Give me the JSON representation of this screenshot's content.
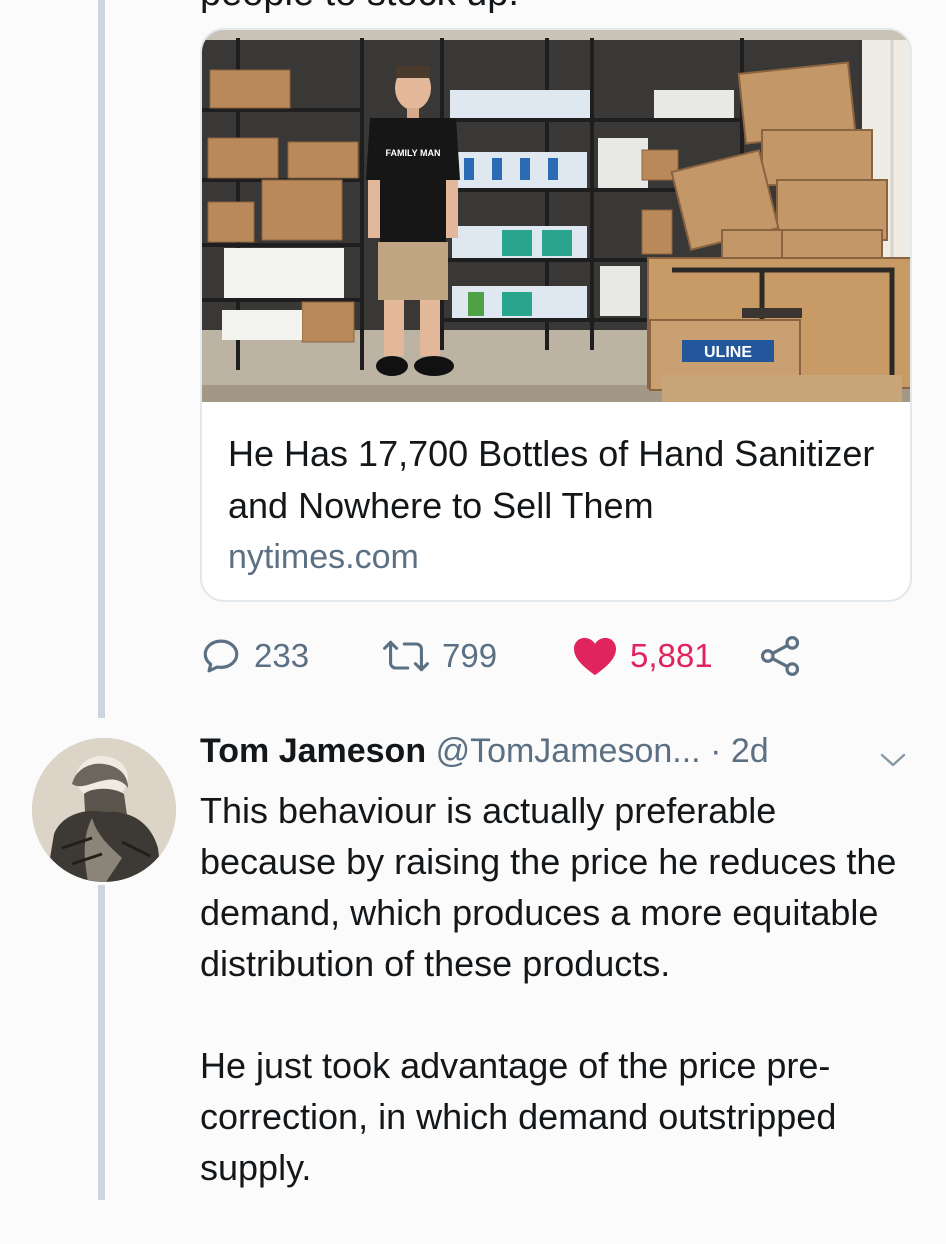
{
  "previous_tweet_tail": "people to stock up.",
  "card": {
    "title": "He Has 17,700 Bottles of Hand Sanitizer and Nowhere to Sell Them",
    "domain": "nytimes.com",
    "image": {
      "shirt_text": "FAMILY MAN",
      "box_label": "ULINE"
    }
  },
  "actions": {
    "reply_count": "233",
    "retweet_count": "799",
    "like_count": "5,881",
    "liked": true
  },
  "reply": {
    "name": "Tom Jameson",
    "handle": "@TomJameson...",
    "separator": "·",
    "time": "2d",
    "paragraphs": [
      "This behaviour is actually preferable because by raising the price he reduces the demand, which produces a more equitable distribution of these products.",
      "He just took advantage of the price pre-correction, in which demand outstripped supply."
    ]
  },
  "colors": {
    "accent_like": "#e0245e",
    "secondary_text": "#5b7083",
    "thread_line": "#cdd6df"
  }
}
